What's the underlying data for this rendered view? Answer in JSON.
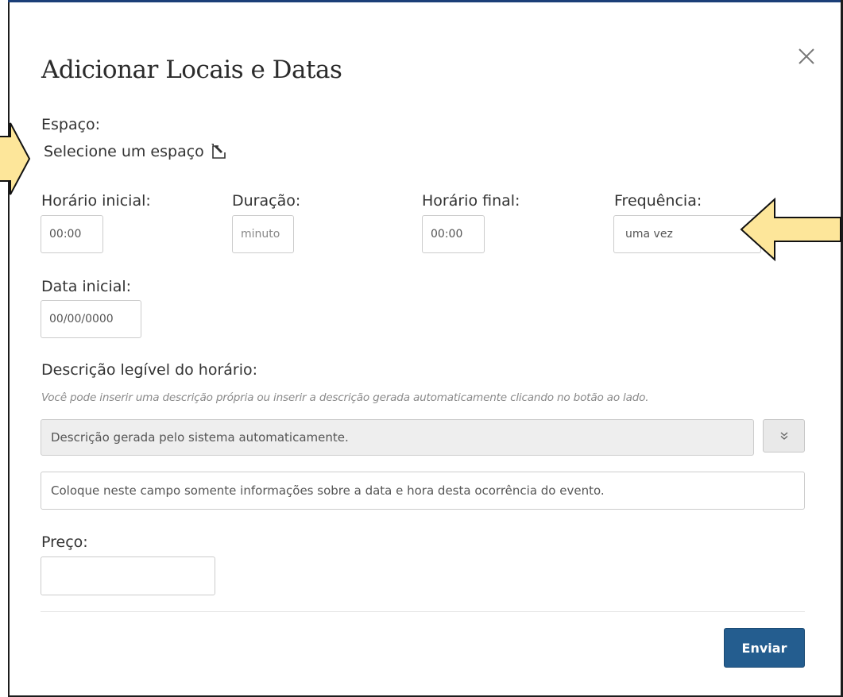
{
  "modal": {
    "title": "Adicionar Locais e Datas",
    "space_label": "Espaço:",
    "space_select_text": "Selecione um espaço",
    "start_time_label": "Horário inicial:",
    "start_time_value": "00:00",
    "duration_label": "Duração:",
    "duration_placeholder": "minuto",
    "end_time_label": "Horário final:",
    "end_time_value": "00:00",
    "frequency_label": "Frequência:",
    "frequency_value": "uma vez",
    "start_date_label": "Data inicial:",
    "start_date_value": "00/00/0000",
    "readable_desc_label": "Descrição legível do horário:",
    "readable_desc_hint": "Você pode inserir uma descrição própria ou inserir a descrição gerada automaticamente clicando no botão ao lado.",
    "auto_desc_text": "Descrição gerada pelo sistema automaticamente.",
    "custom_desc_placeholder": "Coloque neste campo somente informações sobre a data e hora desta ocorrência do evento.",
    "price_label": "Preço:",
    "price_value": "",
    "submit_label": "Enviar"
  },
  "icons": {
    "close": "close-icon",
    "edit": "edit-pencil-icon",
    "expand": "chevron-double-down-icon"
  },
  "colors": {
    "submit_bg": "#245d8f",
    "annotation_arrow_fill": "#fde69a",
    "annotation_arrow_stroke": "#111111",
    "top_bar": "#1b3f78"
  }
}
